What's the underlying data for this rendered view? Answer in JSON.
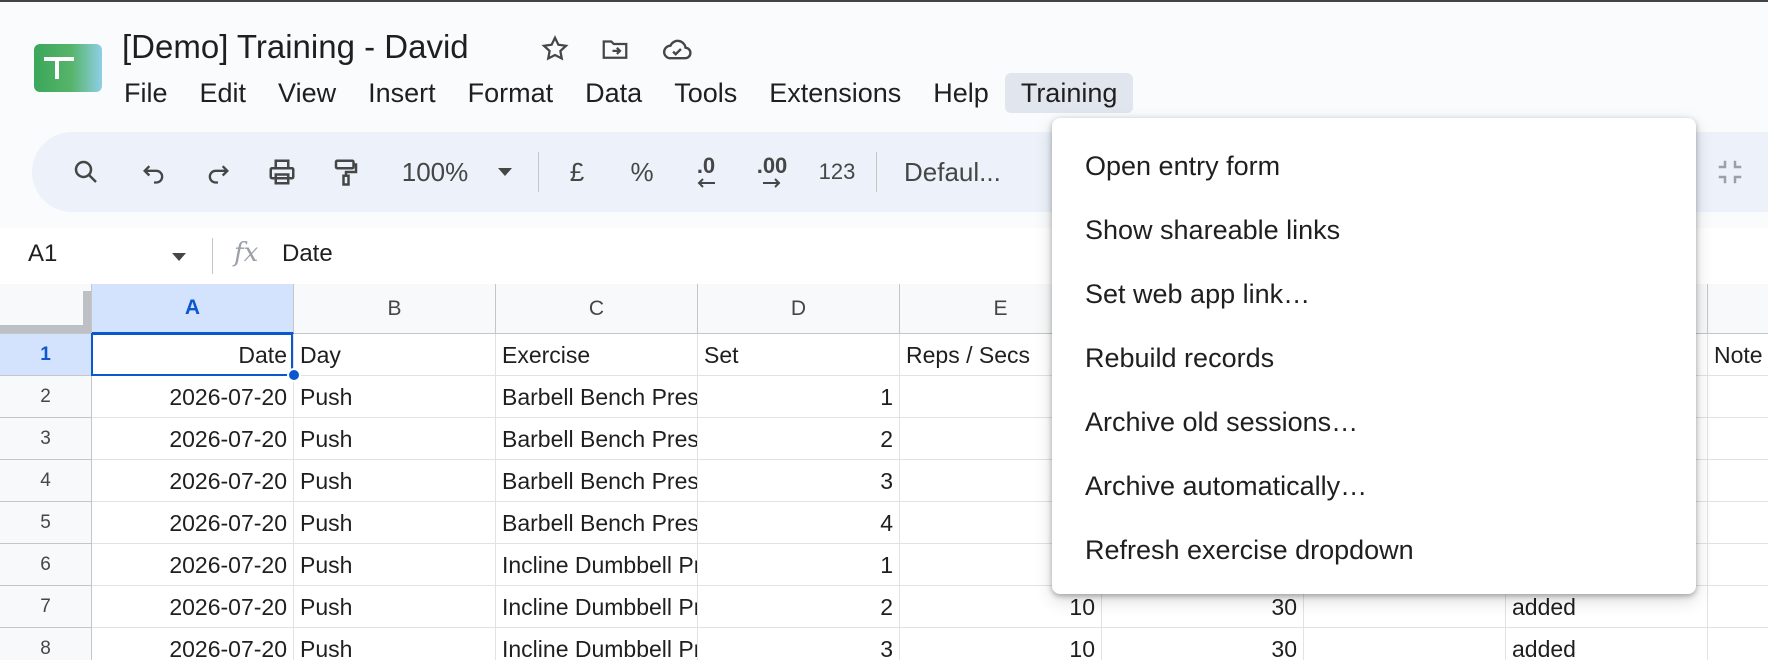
{
  "document": {
    "title": "[Demo] Training - David"
  },
  "menubar": [
    "File",
    "Edit",
    "View",
    "Insert",
    "Format",
    "Data",
    "Tools",
    "Extensions",
    "Help",
    "Training"
  ],
  "toolbar": {
    "zoom": "100%",
    "currency": "£",
    "percent": "%",
    "decrease_decimal": ".0",
    "increase_decimal": ".00",
    "more_formats": "123",
    "font": "Defaul..."
  },
  "formula_bar": {
    "cell_ref": "A1",
    "fx": "fx",
    "value": "Date"
  },
  "grid": {
    "columns": [
      "A",
      "B",
      "C",
      "D",
      "E"
    ],
    "rows": [
      {
        "num": "1",
        "a": "Date",
        "b": "Day",
        "c": "Exercise",
        "d": "Set",
        "e": "Reps / Secs",
        "i": "Note"
      },
      {
        "num": "2",
        "a": "2026-07-20",
        "b": "Push",
        "c": "Barbell Bench Press",
        "d": "1"
      },
      {
        "num": "3",
        "a": "2026-07-20",
        "b": "Push",
        "c": "Barbell Bench Press",
        "d": "2"
      },
      {
        "num": "4",
        "a": "2026-07-20",
        "b": "Push",
        "c": "Barbell Bench Press",
        "d": "3"
      },
      {
        "num": "5",
        "a": "2026-07-20",
        "b": "Push",
        "c": "Barbell Bench Press",
        "d": "4"
      },
      {
        "num": "6",
        "a": "2026-07-20",
        "b": "Push",
        "c": "Incline Dumbbell Press",
        "d": "1"
      },
      {
        "num": "7",
        "a": "2026-07-20",
        "b": "Push",
        "c": "Incline Dumbbell Press",
        "d": "2",
        "e": "10",
        "f": "30",
        "h": "added"
      },
      {
        "num": "8",
        "a": "2026-07-20",
        "b": "Push",
        "c": "Incline Dumbbell Press",
        "d": "3",
        "e": "10",
        "f": "30",
        "h": "added"
      }
    ]
  },
  "training_menu": {
    "items": [
      "Open entry form",
      "Show shareable links",
      "Set web app link…",
      "Rebuild records",
      "Archive old sessions…",
      "Archive automatically…",
      "Refresh exercise dropdown"
    ]
  }
}
